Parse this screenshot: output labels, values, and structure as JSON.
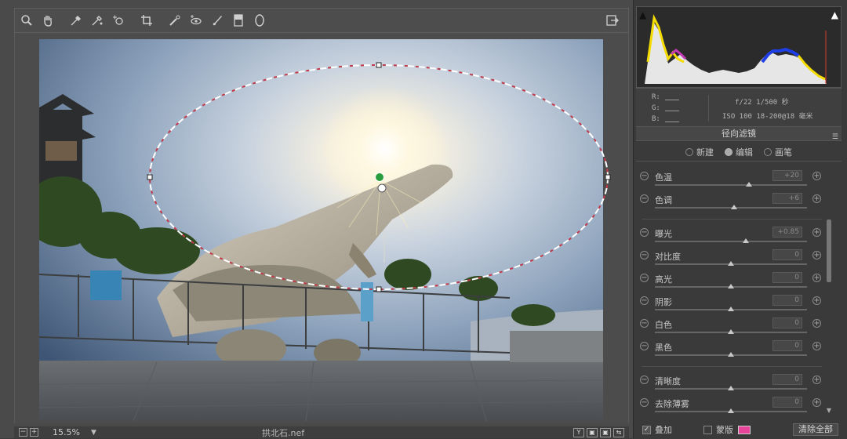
{
  "toolbar": {
    "tools": [
      "zoom-icon",
      "hand-icon",
      "eyedropper-icon",
      "color-sampler-icon",
      "target-adjust-icon",
      "crop-icon",
      "spot-removal-icon",
      "red-eye-icon",
      "adjustment-brush-icon",
      "graduated-filter-icon",
      "radial-filter-icon"
    ],
    "export_icon": "export-icon"
  },
  "status_bar": {
    "zoom_value": "15.5%",
    "filename": "拱北石.nef",
    "view_buttons": [
      "Y",
      "▣",
      "▣",
      "⇆"
    ]
  },
  "histogram": {
    "clip_shadow_icon": "shadow-clip-icon",
    "clip_highlight_icon": "highlight-clip-icon"
  },
  "info": {
    "r_label": "R:",
    "g_label": "G:",
    "b_label": "B:",
    "aperture_shutter": "f/22  1/500 秒",
    "iso_lens": "ISO 100  18-200@18 毫米"
  },
  "panel": {
    "title": "径向滤镜",
    "modes": [
      {
        "label": "新建",
        "selected": false
      },
      {
        "label": "编辑",
        "selected": true
      },
      {
        "label": "画笔",
        "selected": false
      }
    ],
    "sliders": [
      {
        "label": "色温",
        "value": "+20",
        "pos": 0.62
      },
      {
        "label": "色调",
        "value": "+6",
        "pos": 0.52
      },
      {
        "label": "曝光",
        "value": "+0.85",
        "pos": 0.6
      },
      {
        "label": "对比度",
        "value": "0",
        "pos": 0.5
      },
      {
        "label": "高光",
        "value": "0",
        "pos": 0.5
      },
      {
        "label": "阴影",
        "value": "0",
        "pos": 0.5
      },
      {
        "label": "白色",
        "value": "0",
        "pos": 0.5
      },
      {
        "label": "黑色",
        "value": "0",
        "pos": 0.5
      },
      {
        "label": "清晰度",
        "value": "0",
        "pos": 0.5
      },
      {
        "label": "去除薄雾",
        "value": "0",
        "pos": 0.5
      }
    ]
  },
  "footer": {
    "overlay_label": "叠加",
    "overlay_checked": true,
    "mask_label": "蒙版",
    "mask_checked": false,
    "mask_color": "#e8449a",
    "clear_all_label": "清除全部"
  }
}
